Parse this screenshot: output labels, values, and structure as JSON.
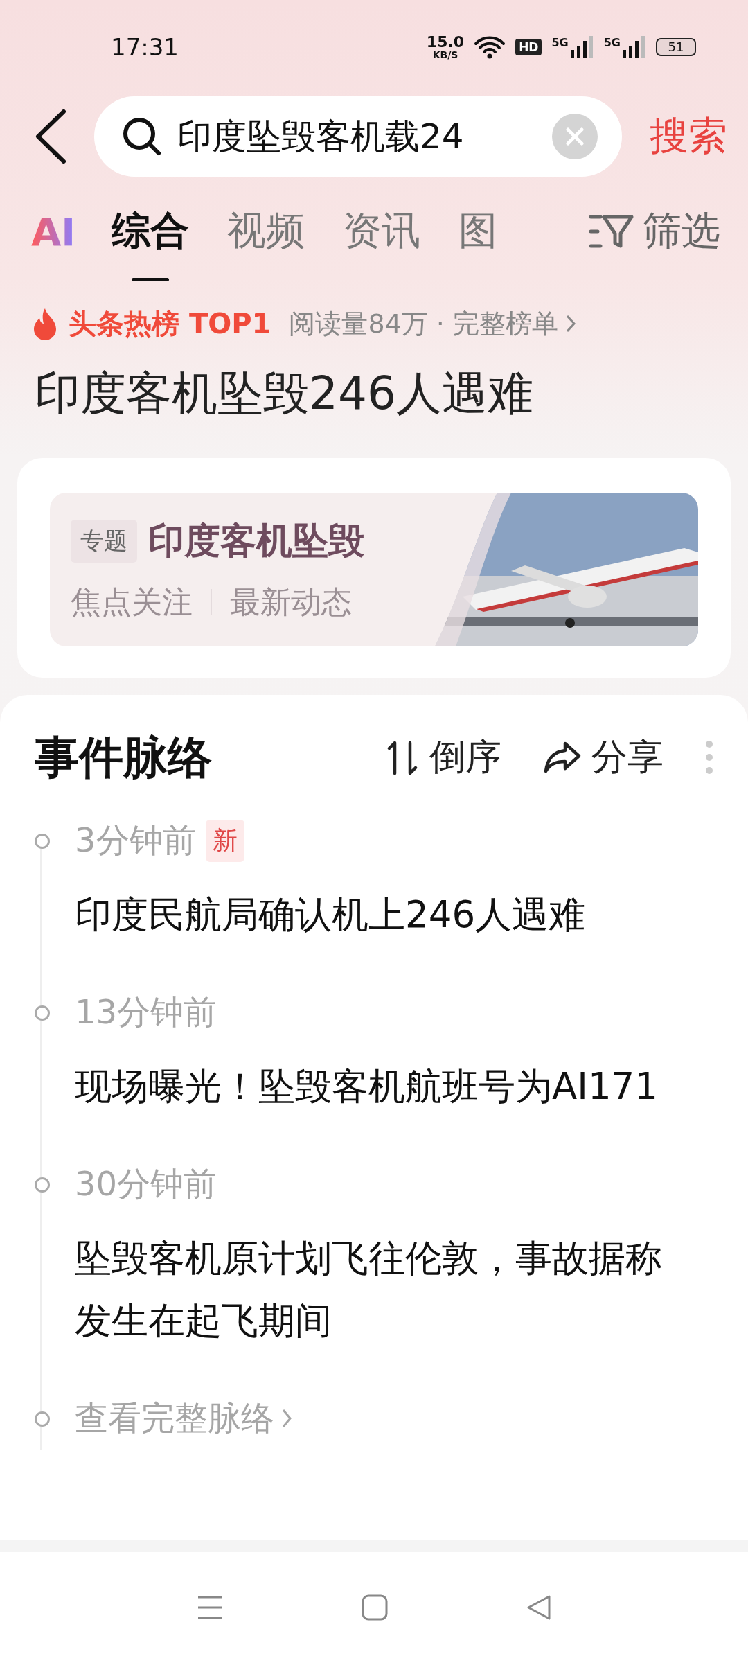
{
  "status_bar": {
    "time": "17:31",
    "speed": "15.0",
    "speed_unit": "KB/S",
    "hd": "HD",
    "networks": [
      "5G",
      "5G"
    ],
    "battery": "51"
  },
  "search": {
    "value": "印度坠毁客机载24",
    "button": "搜索"
  },
  "tabs": [
    {
      "label": "综合",
      "selected": true
    },
    {
      "label": "视频",
      "selected": false
    },
    {
      "label": "资讯",
      "selected": false
    },
    {
      "label": "图",
      "selected": false
    }
  ],
  "filter": "筛选",
  "ai_label": "AI",
  "hot": {
    "rank": "头条热榜 TOP1",
    "reads": "阅读量84万 · 完整榜单"
  },
  "headline": "印度客机坠毁246人遇难",
  "topic_card": {
    "tag": "专题",
    "title": "印度客机坠毁",
    "links": [
      "焦点关注",
      "最新动态"
    ],
    "image": {
      "kind": "picture"
    }
  },
  "timeline": {
    "title": "事件脉络",
    "sort": "倒序",
    "share": "分享",
    "items": [
      {
        "time": "3分钟前",
        "badge": "新",
        "text": "印度民航局确认机上246人遇难"
      },
      {
        "time": "13分钟前",
        "text": "现场曝光！坠毁客机航班号为AI171"
      },
      {
        "time": "30分钟前",
        "text": "坠毁客机原计划飞往伦敦，事故据称发生在起飞期间"
      }
    ],
    "more": "查看完整脉络"
  }
}
